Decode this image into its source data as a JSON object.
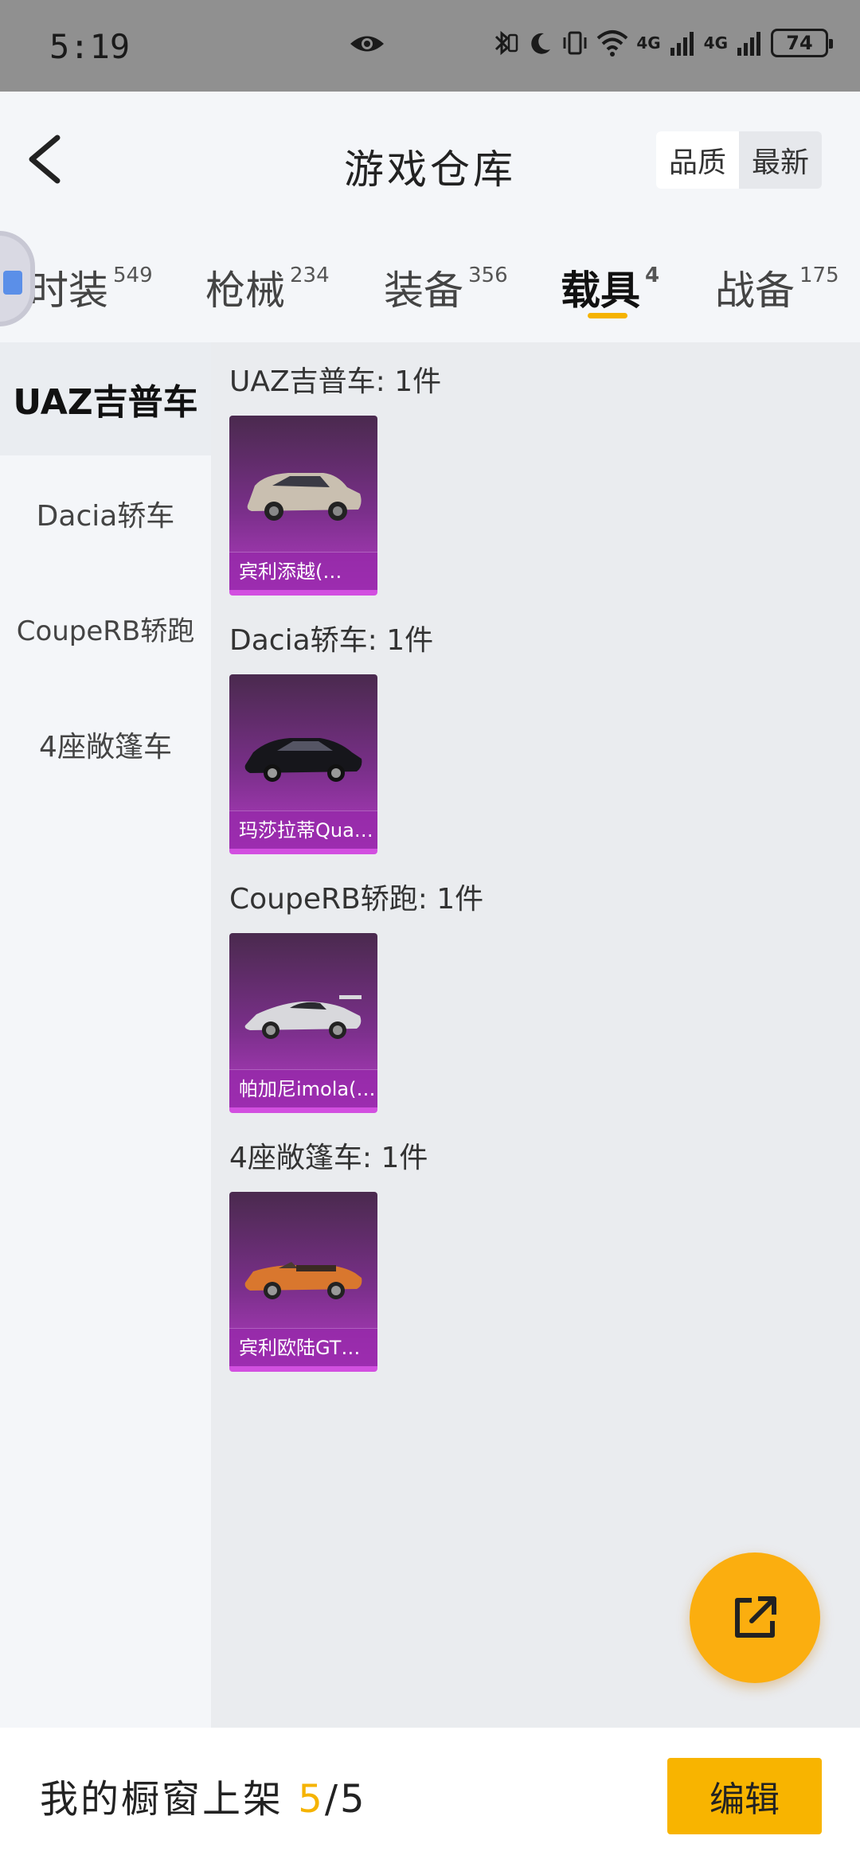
{
  "status_bar": {
    "time": "5:19",
    "battery": "74",
    "signal_1": "4G",
    "signal_2": "4G"
  },
  "header": {
    "title": "游戏仓库",
    "sort_options": [
      "品质",
      "最新"
    ],
    "active_sort": "品质"
  },
  "tabs": [
    {
      "label": "时装",
      "count": "549"
    },
    {
      "label": "枪械",
      "count": "234"
    },
    {
      "label": "装备",
      "count": "356"
    },
    {
      "label": "载具",
      "count": "4",
      "active": true
    },
    {
      "label": "战备",
      "count": "175"
    }
  ],
  "sidebar": {
    "items": [
      "UAZ吉普车",
      "Dacia轿车",
      "CoupeRB轿跑",
      "4座敞篷车"
    ]
  },
  "groups": [
    {
      "title": "UAZ吉普车: 1件",
      "item_name": "宾利添越(…",
      "car_color": "#c9bfb0"
    },
    {
      "title": "Dacia轿车: 1件",
      "item_name": "玛莎拉蒂Qua…",
      "car_color": "#1a1a1f"
    },
    {
      "title": "CoupeRB轿跑: 1件",
      "item_name": "帕加尼imola(…",
      "car_color": "#d8d8dc"
    },
    {
      "title": "4座敞篷车: 1件",
      "item_name": "宾利欧陆GT…",
      "car_color": "#d9772e"
    }
  ],
  "bottom_bar": {
    "shelf_label": "我的橱窗上架",
    "shelf_current": "5",
    "shelf_total": "/5",
    "edit_label": "编辑"
  },
  "colors": {
    "accent": "#f8b400",
    "card_purple": "#7a2f8a",
    "status_bar_bg": "#909090"
  }
}
